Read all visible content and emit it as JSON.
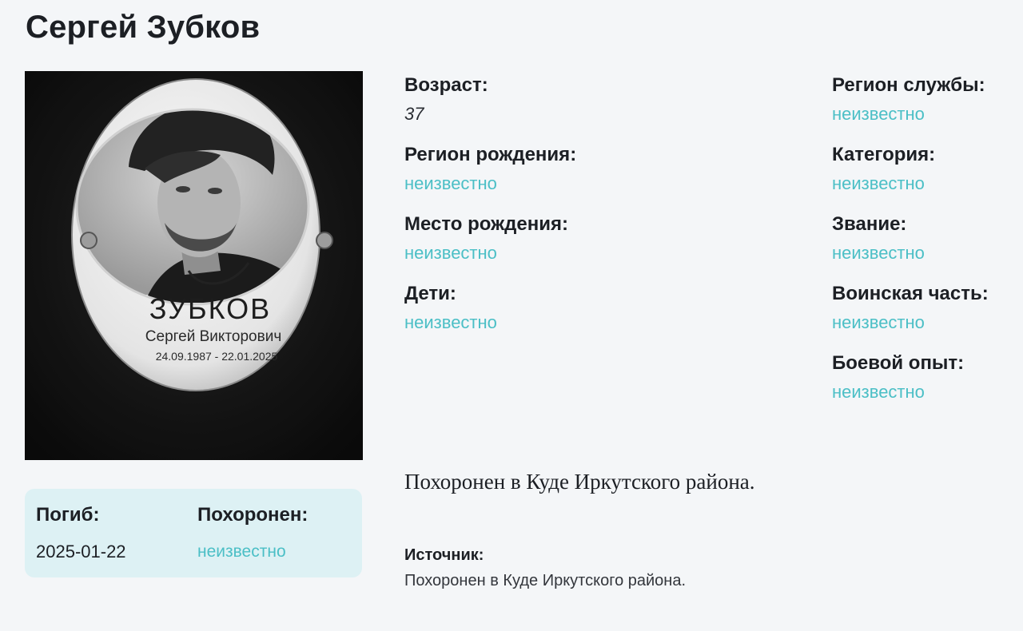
{
  "page": {
    "title": "Сергей Зубков"
  },
  "photo": {
    "alt": "Фото с памятника",
    "plaque": {
      "surname": "ЗУБКОВ",
      "full_name": "Сергей Викторович",
      "dates": "24.09.1987 - 22.01.2025"
    }
  },
  "death_card": {
    "died_label": "Погиб:",
    "died_value": "2025-01-22",
    "buried_label": "Похоронен:",
    "buried_value": "неизвестно"
  },
  "fields_left": [
    {
      "label": "Возраст:",
      "value": "37"
    },
    {
      "label": "Регион рождения:",
      "value": "неизвестно"
    },
    {
      "label": "Место рождения:",
      "value": "неизвестно"
    },
    {
      "label": "Дети:",
      "value": "неизвестно"
    }
  ],
  "fields_right": [
    {
      "label": "Регион службы:",
      "value": "неизвестно"
    },
    {
      "label": "Категория:",
      "value": "неизвестно"
    },
    {
      "label": "Звание:",
      "value": "неизвестно"
    },
    {
      "label": "Воинская часть:",
      "value": "неизвестно"
    },
    {
      "label": "Боевой опыт:",
      "value": "неизвестно"
    }
  ],
  "summary": "Похоронен в Куде Иркутского района.",
  "source": {
    "label": "Источник:",
    "text": "Похоронен в Куде Иркутского района."
  },
  "colors": {
    "link": "#4bbfc6",
    "card_bg": "#ddf1f4",
    "page_bg": "#f4f6f8"
  }
}
